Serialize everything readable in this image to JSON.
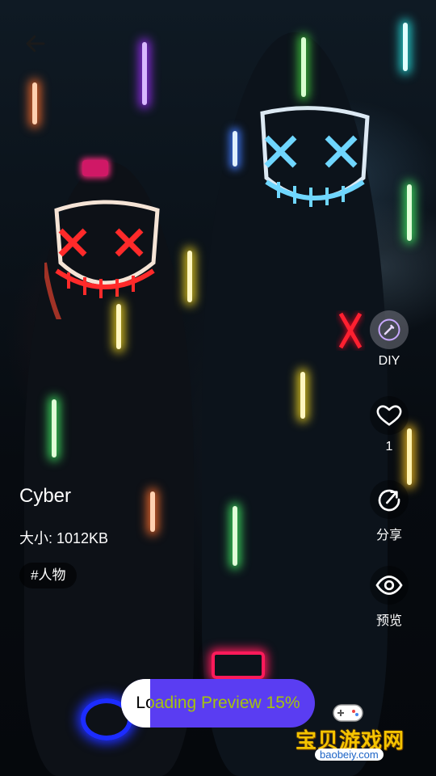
{
  "header": {
    "back_icon": "arrow-left-icon"
  },
  "wallpaper": {
    "title": "Cyber",
    "size_text": "大小: 1012KB",
    "tag": "#人物"
  },
  "actions": {
    "diy": {
      "label": "DIY",
      "icon": "pencil-icon"
    },
    "like": {
      "count": "1",
      "icon": "heart-icon"
    },
    "share": {
      "label": "分享",
      "icon": "share-icon"
    },
    "preview": {
      "label": "预览",
      "icon": "eye-icon"
    }
  },
  "loading": {
    "text": "Loading Preview 15%",
    "progress": 0.15
  },
  "watermark": {
    "brand": "宝贝游戏网",
    "url": "baobeiy.com"
  },
  "colors": {
    "accent": "#5a3df2"
  }
}
